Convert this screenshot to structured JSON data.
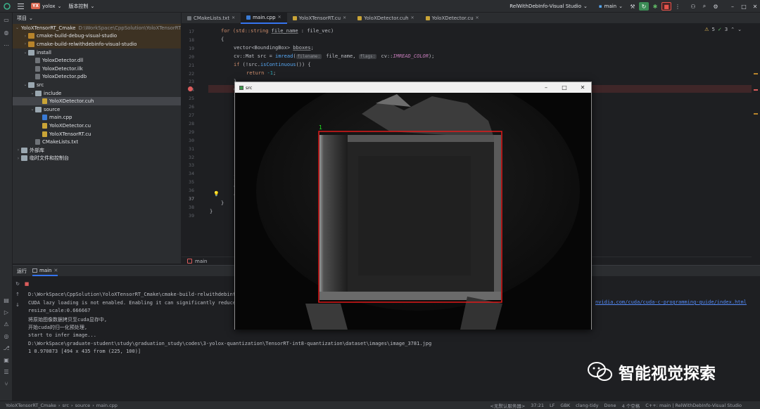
{
  "titlebar": {
    "project_badge": "YX",
    "project_name": "yolox",
    "vcs_label": "版本控制",
    "run_config": "RelWithDebInfo-Visual Studio",
    "branch": "main"
  },
  "project_panel": {
    "header": "项目",
    "tree": [
      {
        "label": "YoloXTensorRT_Cmake",
        "detail": "D:\\WorkSpace\\CppSolution\\YoloXTensorRT_Cm",
        "depth": 0,
        "kind": "folder",
        "open": true
      },
      {
        "label": "cmake-build-debug-visual-studio",
        "depth": 1,
        "kind": "folder-orange",
        "open": false
      },
      {
        "label": "cmake-build-relwithdebinfo-visual-studio",
        "depth": 1,
        "kind": "folder-orange",
        "open": false
      },
      {
        "label": "install",
        "depth": 1,
        "kind": "folder",
        "open": true
      },
      {
        "label": "YoloxDetector.dll",
        "depth": 2,
        "kind": "file"
      },
      {
        "label": "YoloxDetector.ilk",
        "depth": 2,
        "kind": "file"
      },
      {
        "label": "YoloxDetector.pdb",
        "depth": 2,
        "kind": "file"
      },
      {
        "label": "src",
        "depth": 1,
        "kind": "folder",
        "open": true
      },
      {
        "label": "include",
        "depth": 2,
        "kind": "folder",
        "open": true
      },
      {
        "label": "YoloXDetector.cuh",
        "depth": 3,
        "kind": "cu",
        "selected": true
      },
      {
        "label": "source",
        "depth": 2,
        "kind": "folder",
        "open": true
      },
      {
        "label": "main.cpp",
        "depth": 3,
        "kind": "cpp"
      },
      {
        "label": "YoloXDetector.cu",
        "depth": 3,
        "kind": "cu"
      },
      {
        "label": "YoloXTensorRT.cu",
        "depth": 3,
        "kind": "cu"
      },
      {
        "label": "CMakeLists.txt",
        "depth": 2,
        "kind": "file"
      },
      {
        "label": "外部库",
        "depth": 0,
        "kind": "lib",
        "open": false
      },
      {
        "label": "临时文件和控制台",
        "depth": 0,
        "kind": "lib",
        "open": false
      }
    ]
  },
  "tabs": [
    {
      "label": "CMakeLists.txt",
      "color": "#6f7378"
    },
    {
      "label": "main.cpp",
      "color": "#3a7bd5",
      "active": true
    },
    {
      "label": "YoloXTensorRT.cu",
      "color": "#c9a437"
    },
    {
      "label": "YoloXDetector.cuh",
      "color": "#c9a437"
    },
    {
      "label": "YoloXDetector.cu",
      "color": "#c9a437"
    }
  ],
  "editor": {
    "warnings": "5",
    "checks": "3",
    "line_numbers": [
      "17",
      "18",
      "19",
      "20",
      "21",
      "22",
      "23",
      "24",
      "25",
      "26",
      "27",
      "28",
      "29",
      "30",
      "31",
      "32",
      "33",
      "34",
      "35",
      "36",
      "37",
      "38",
      "39"
    ],
    "lines": {
      "l17_a": "for (std::string ",
      "l17_b": "file_name",
      "l17_c": " : file_vec)",
      "l18": "{",
      "l19_a": "vector<BoundingBox> ",
      "l19_b": "bboxes",
      "l19_c": ";",
      "l20_a": "cv::Mat src = ",
      "l20_fn": "imread",
      "l20_b": "(",
      "l20_hint1": "filename:",
      "l20_c": " file_name, ",
      "l20_hint2": "flags:",
      "l20_d": " cv::",
      "l20_e": "IMREAD_COLOR",
      "l20_f": ");",
      "l21_a": "if",
      "l21_b": " (!src.",
      "l21_fn": "isContinuous",
      "l21_c": "()) {",
      "l22_a": "return ",
      "l22_b": "-1",
      "l22_c": ";",
      "l23": "}",
      "l24": "d",
      "l25": "f",
      "l34": "}",
      "l35": "c",
      "l36": "c",
      "l38": "}",
      "l39": "}"
    },
    "function_breadcrumb": "main"
  },
  "src_window": {
    "title": "src",
    "detection_label": "1"
  },
  "run_panel": {
    "title": "运行",
    "tab": "main",
    "console": [
      "D:\\WorkSpace\\CppSolution\\YoloXTensorRT_Cmake\\cmake-build-relwithdebint",
      "CUDA lazy loading is not enabled. Enabling it can significantly reduce",
      "resize_scale:0.666667",
      "将原始图像数据拷贝至cuda显存中,",
      "开始cuda的归一化预处理,",
      "start to infer image...",
      "D:\\WorkSpace\\graduate-student\\study\\graduation_study\\codes\\3-yolox-quantization\\TensorRT-int8-quantization\\dataset\\images\\image_3781.jpg",
      "1 0.970873 [494 x 435 from (225, 100)]"
    ],
    "link": "nvidia.com/cuda/cuda-c-programming-guide/index.html"
  },
  "statusbar": {
    "crumbs": [
      "YoloXTensorRT_Cmake",
      "src",
      "source",
      "main.cpp"
    ],
    "right": [
      "<无默认服务器>",
      "37:21",
      "LF",
      "GBK",
      "clang-tidy",
      "Done",
      "4 个空格",
      "C++: main | RelWithDebInfo-Visual Studio"
    ]
  },
  "watermark": {
    "text": "智能视觉探索"
  }
}
